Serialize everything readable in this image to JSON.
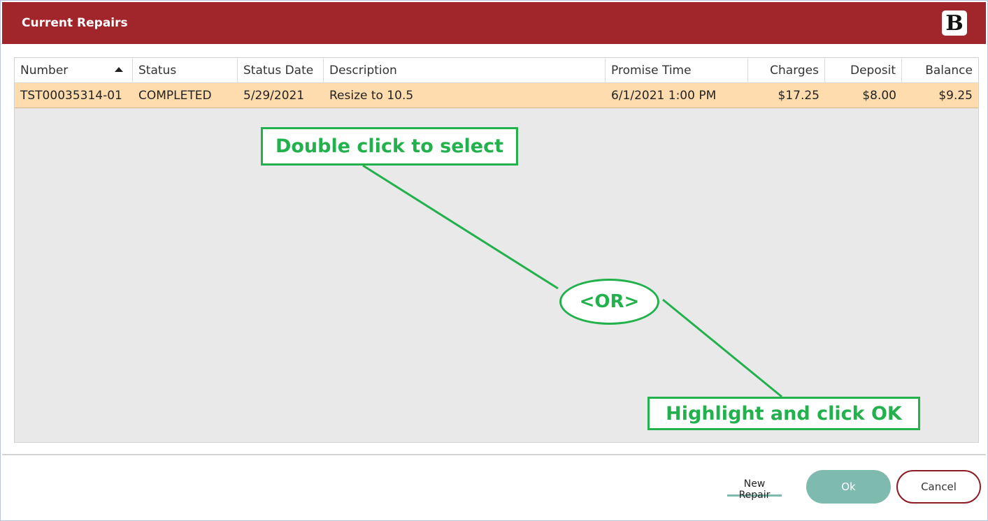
{
  "window": {
    "title": "Current Repairs",
    "logo_letter": "B"
  },
  "table": {
    "columns": [
      "Number",
      "Status",
      "Status Date",
      "Description",
      "Promise Time",
      "Charges",
      "Deposit",
      "Balance"
    ],
    "sort_column": "Number",
    "sort_direction": "ascending",
    "rows": [
      {
        "number": "TST00035314-01",
        "status": "COMPLETED",
        "status_date": "5/29/2021",
        "description": "Resize to 10.5",
        "promise_time": "6/1/2021 1:00 PM",
        "charges": "$17.25",
        "deposit": "$8.00",
        "balance": "$9.25"
      }
    ]
  },
  "annotations": {
    "double_click": "Double click to select",
    "or": "<OR>",
    "highlight": "Highlight and click OK",
    "color": "#22b14c"
  },
  "footer": {
    "new_repair": "New Repair",
    "ok": "Ok",
    "cancel": "Cancel"
  },
  "colors": {
    "titlebar": "#a0262b",
    "selected_row": "#ffdcad",
    "ok_button": "#7fbaae",
    "cancel_border": "#8b1c24"
  }
}
